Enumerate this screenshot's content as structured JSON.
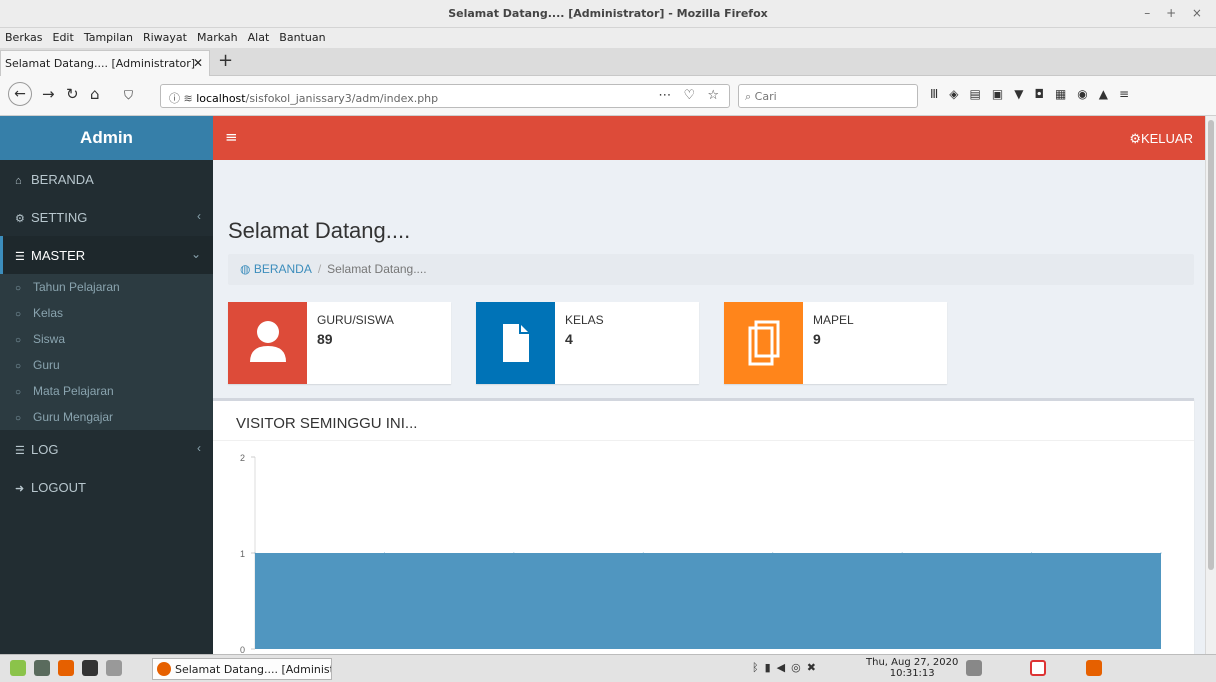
{
  "window": {
    "title": "Selamat Datang.... [Administrator] - Mozilla Firefox",
    "controls": "– + ×"
  },
  "menu": [
    "Berkas",
    "Edit",
    "Tampilan",
    "Riwayat",
    "Markah",
    "Alat",
    "Bantuan"
  ],
  "tab": {
    "label": "Selamat Datang.... [Administrator]",
    "close": "✕",
    "new": "+"
  },
  "url": {
    "host": "localhost",
    "path": "/sisfokol_janissary3/adm/index.php"
  },
  "search": {
    "placeholder": "Cari"
  },
  "app": {
    "brand": "Admin",
    "logout_top": "KELUAR",
    "menu": [
      {
        "label": "BERANDA",
        "icon": "home-icon"
      },
      {
        "label": "SETTING",
        "icon": "gears-icon"
      },
      {
        "label": "MASTER",
        "icon": "database-icon"
      }
    ],
    "submenu": [
      "Tahun Pelajaran",
      "Kelas",
      "Siswa",
      "Guru",
      "Mata Pelajaran",
      "Guru Mengajar"
    ],
    "menu2": [
      {
        "label": "LOG",
        "icon": "database-icon"
      },
      {
        "label": "LOGOUT",
        "icon": "sign-out-icon"
      }
    ],
    "page_title": "Selamat Datang....",
    "breadcrumb": {
      "home": "BERANDA",
      "current": "Selamat Datang...."
    },
    "stats": [
      {
        "label": "GURU/SISWA",
        "value": "89",
        "color": "#dd4b39",
        "icon": "user-icon"
      },
      {
        "label": "KELAS",
        "value": "4",
        "color": "#0073b7",
        "icon": "file-icon"
      },
      {
        "label": "MAPEL",
        "value": "9",
        "color": "#ff851b",
        "icon": "files-icon"
      }
    ],
    "chart_title": "VISITOR SEMINGGU INI..."
  },
  "chart_data": {
    "type": "area",
    "title": "VISITOR SEMINGGU INI...",
    "yticks": [
      "2",
      "1",
      "0"
    ],
    "ylim": [
      0,
      2
    ],
    "values": [
      1,
      1,
      1,
      1,
      1,
      1,
      1,
      1
    ],
    "color": "#5096c0"
  },
  "taskbar": {
    "app_label": "Selamat Datang.... [Administ...",
    "date": "Thu, Aug 27, 2020",
    "time": "10:31:13"
  }
}
